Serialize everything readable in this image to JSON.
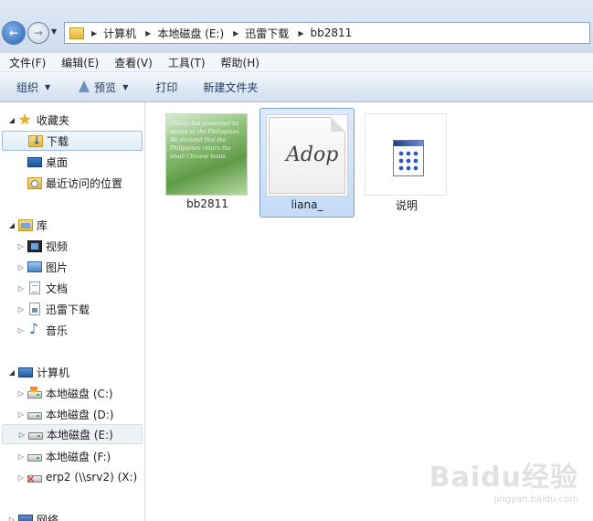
{
  "address": {
    "segments": [
      "计算机",
      "本地磁盘 (E:)",
      "迅雷下载",
      "bb2811"
    ]
  },
  "menu": [
    "文件(F)",
    "编辑(E)",
    "查看(V)",
    "工具(T)",
    "帮助(H)"
  ],
  "toolbar": {
    "organize": "组织",
    "preview": "预览",
    "print": "打印",
    "new_folder": "新建文件夹"
  },
  "nav": {
    "favorites": "收藏夹",
    "downloads": "下载",
    "desktop": "桌面",
    "recent": "最近访问的位置",
    "libraries": "库",
    "videos": "视频",
    "pictures": "图片",
    "documents": "文档",
    "xunlei": "迅雷下载",
    "music": "音乐",
    "computer": "计算机",
    "drive_c": "本地磁盘 (C:)",
    "drive_d": "本地磁盘 (D:)",
    "drive_e": "本地磁盘 (E:)",
    "drive_f": "本地磁盘 (F:)",
    "net_drive": "erp2 (\\\\srv2) (X:)",
    "network": "网络"
  },
  "files": [
    {
      "name": "bb2811",
      "selected": false
    },
    {
      "name": "liana_",
      "selected": true
    },
    {
      "name": "说明",
      "selected": false
    }
  ],
  "thumb_text": "Chisun has presented its stance to the Philippines. We demand that the Philippines return the small Chinese boats",
  "signature_text": "Adop",
  "watermark": {
    "brand": "Baidu经验",
    "site": "jingyan.baidu.com"
  }
}
